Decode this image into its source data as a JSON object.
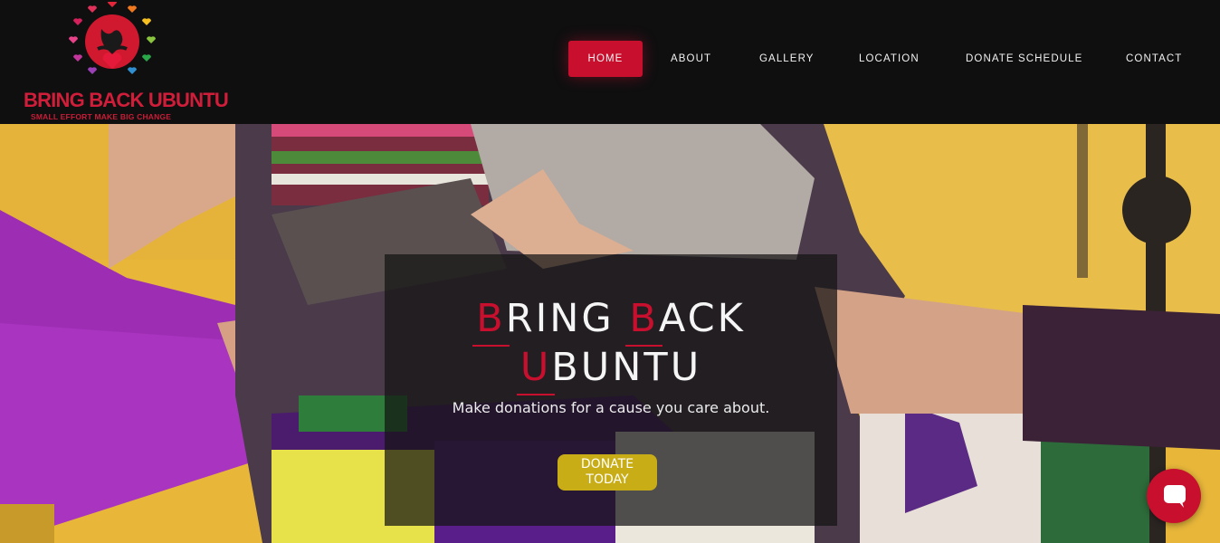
{
  "brand": {
    "name": "BRING BACK UBUNTU",
    "tagline": "SMALL EFFORT MAKE BIG CHANGE",
    "logo_icon": "heart-hands-icon"
  },
  "nav": {
    "items": [
      {
        "label": "HOME",
        "active": true
      },
      {
        "label": "ABOUT",
        "active": false
      },
      {
        "label": "GALLERY",
        "active": false
      },
      {
        "label": "LOCATION",
        "active": false
      },
      {
        "label": "DONATE SCHEDULE",
        "active": false
      },
      {
        "label": "CONTACT",
        "active": false
      }
    ]
  },
  "hero": {
    "heading_line1_initial1": "B",
    "heading_line1_rest1": "RING ",
    "heading_line1_initial2": "B",
    "heading_line1_rest2": "ACK",
    "heading_line2_initial": "U",
    "heading_line2_rest": "BUNTU",
    "subtitle": "Make donations for a cause you care about.",
    "cta_line1": "DONATE",
    "cta_line2": "TODAY"
  },
  "chat": {
    "icon": "chat-bubble-icon"
  },
  "colors": {
    "header_bg": "#0f0f10",
    "accent_red": "#c8102e",
    "cta_gold": "#c8ad17",
    "panel_overlay": "rgba(20,20,20,0.72)"
  }
}
